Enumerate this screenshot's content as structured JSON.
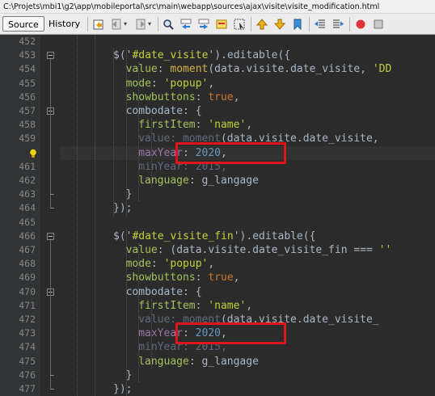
{
  "window": {
    "file_path": "C:\\Projets\\mbi1\\g2\\app\\mobileportal\\src\\main\\webapp\\sources\\ajax\\visite\\visite_modification.html"
  },
  "tabs": [
    {
      "label": "Source",
      "active": true
    },
    {
      "label": "History",
      "active": false
    }
  ],
  "toolbar_icons": [
    "last-edit-icon",
    "back-icon",
    "forward-icon",
    "find-icon",
    "find-previous-icon",
    "find-next-icon",
    "toggle-highlight-icon",
    "toggle-rect-select-icon",
    "previous-bookmark-icon",
    "next-bookmark-icon",
    "toggle-bookmark-icon",
    "shift-left-icon",
    "shift-right-icon",
    "record-macro-icon",
    "stop-macro-icon"
  ],
  "lines": [
    {
      "num": "452",
      "tokens": []
    },
    {
      "num": "453",
      "tokens": [
        {
          "t": "$('",
          "c": "plain"
        },
        {
          "t": "#date_visite",
          "c": "lime"
        },
        {
          "t": "').editable({",
          "c": "plain"
        }
      ]
    },
    {
      "num": "454",
      "tokens": [
        {
          "t": "value",
          "c": "green"
        },
        {
          "t": ": ",
          "c": "plain"
        },
        {
          "t": "moment",
          "c": "moment"
        },
        {
          "t": "(data.visite.date_visite, ",
          "c": "plain"
        },
        {
          "t": "'DD",
          "c": "lime"
        }
      ]
    },
    {
      "num": "455",
      "tokens": [
        {
          "t": "mode",
          "c": "green"
        },
        {
          "t": ": ",
          "c": "plain"
        },
        {
          "t": "'popup'",
          "c": "lime"
        },
        {
          "t": ",",
          "c": "plain"
        }
      ]
    },
    {
      "num": "456",
      "tokens": [
        {
          "t": "showbuttons",
          "c": "green"
        },
        {
          "t": ": ",
          "c": "plain"
        },
        {
          "t": "true",
          "c": "kw"
        },
        {
          "t": ",",
          "c": "plain"
        }
      ]
    },
    {
      "num": "457",
      "tokens": [
        {
          "t": "combodate",
          "c": "plain"
        },
        {
          "t": ": {",
          "c": "plain"
        }
      ]
    },
    {
      "num": "458",
      "tokens": [
        {
          "t": "firstItem",
          "c": "green"
        },
        {
          "t": ": ",
          "c": "plain"
        },
        {
          "t": "'name'",
          "c": "lime"
        },
        {
          "t": ",",
          "c": "plain"
        }
      ]
    },
    {
      "num": "459",
      "tokens": [
        {
          "t": "value",
          "c": "fade"
        },
        {
          "t": ": ",
          "c": "fade"
        },
        {
          "t": "moment",
          "c": "fade"
        },
        {
          "t": "(data.visite.date_visite,",
          "c": "plain"
        }
      ]
    },
    {
      "num": "",
      "tokens": [
        {
          "t": "maxYear",
          "c": "prop"
        },
        {
          "t": ": ",
          "c": "plain"
        },
        {
          "t": "2020",
          "c": "num"
        },
        {
          "t": ",",
          "c": "plain"
        }
      ]
    },
    {
      "num": "461",
      "tokens": [
        {
          "t": "minYear",
          "c": "fade"
        },
        {
          "t": ": ",
          "c": "fade"
        },
        {
          "t": "2015",
          "c": "fade"
        },
        {
          "t": ",",
          "c": "fade"
        }
      ]
    },
    {
      "num": "462",
      "tokens": [
        {
          "t": "language",
          "c": "green"
        },
        {
          "t": ": g_langage",
          "c": "plain"
        }
      ]
    },
    {
      "num": "463",
      "tokens": [
        {
          "t": "}",
          "c": "plain"
        }
      ]
    },
    {
      "num": "464",
      "tokens": [
        {
          "t": "});",
          "c": "plain"
        }
      ]
    },
    {
      "num": "465",
      "tokens": []
    },
    {
      "num": "466",
      "tokens": [
        {
          "t": "$('",
          "c": "plain"
        },
        {
          "t": "#date_visite_fin",
          "c": "lime"
        },
        {
          "t": "').editable({",
          "c": "plain"
        }
      ]
    },
    {
      "num": "467",
      "tokens": [
        {
          "t": "value",
          "c": "green"
        },
        {
          "t": ": (data.visite.date_visite_fin === ",
          "c": "plain"
        },
        {
          "t": "''",
          "c": "lime"
        }
      ]
    },
    {
      "num": "468",
      "tokens": [
        {
          "t": "mode",
          "c": "green"
        },
        {
          "t": ": ",
          "c": "plain"
        },
        {
          "t": "'popup'",
          "c": "lime"
        },
        {
          "t": ",",
          "c": "plain"
        }
      ]
    },
    {
      "num": "469",
      "tokens": [
        {
          "t": "showbuttons",
          "c": "green"
        },
        {
          "t": ": ",
          "c": "plain"
        },
        {
          "t": "true",
          "c": "kw"
        },
        {
          "t": ",",
          "c": "plain"
        }
      ]
    },
    {
      "num": "470",
      "tokens": [
        {
          "t": "combodate",
          "c": "plain"
        },
        {
          "t": ": {",
          "c": "plain"
        }
      ]
    },
    {
      "num": "471",
      "tokens": [
        {
          "t": "firstItem",
          "c": "green"
        },
        {
          "t": ": ",
          "c": "plain"
        },
        {
          "t": "'name'",
          "c": "lime"
        },
        {
          "t": ",",
          "c": "plain"
        }
      ]
    },
    {
      "num": "472",
      "tokens": [
        {
          "t": "value",
          "c": "fade"
        },
        {
          "t": ": ",
          "c": "fade"
        },
        {
          "t": "moment",
          "c": "fade"
        },
        {
          "t": "(data.visite.date_visite_",
          "c": "plain"
        }
      ]
    },
    {
      "num": "473",
      "tokens": [
        {
          "t": "maxYear",
          "c": "prop"
        },
        {
          "t": ": ",
          "c": "plain"
        },
        {
          "t": "2020",
          "c": "num"
        },
        {
          "t": ",",
          "c": "plain"
        }
      ]
    },
    {
      "num": "474",
      "tokens": [
        {
          "t": "minYear",
          "c": "fade"
        },
        {
          "t": ": ",
          "c": "fade"
        },
        {
          "t": "2015",
          "c": "fade"
        },
        {
          "t": ",",
          "c": "fade"
        }
      ]
    },
    {
      "num": "475",
      "tokens": [
        {
          "t": "language",
          "c": "green"
        },
        {
          "t": ": g_langage",
          "c": "plain"
        }
      ]
    },
    {
      "num": "476",
      "tokens": [
        {
          "t": "}",
          "c": "plain"
        }
      ]
    },
    {
      "num": "477",
      "tokens": [
        {
          "t": "});",
          "c": "plain"
        }
      ]
    }
  ],
  "colors": {
    "highlight_box": "#e0141b",
    "hint_bulb": "#f5d300"
  }
}
